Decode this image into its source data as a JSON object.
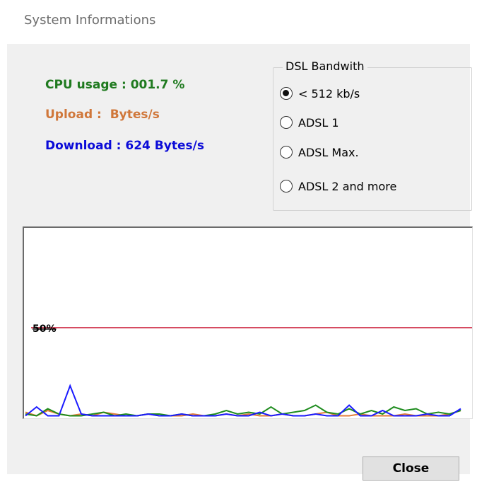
{
  "window": {
    "title": "System Informations"
  },
  "stats": {
    "cpu_label": "CPU usage : ",
    "cpu_value": "001.7 %",
    "upload_label": "Upload : ",
    "upload_value": "Bytes/s",
    "download_label": "Download : ",
    "download_value": "624 Bytes/s"
  },
  "bandwidth": {
    "legend": "DSL Bandwith",
    "options": [
      {
        "label": "< 512 kb/s",
        "checked": true
      },
      {
        "label": "ADSL 1",
        "checked": false
      },
      {
        "label": "ADSL Max.",
        "checked": false
      },
      {
        "label": "ADSL 2 and more",
        "checked": false
      }
    ]
  },
  "graph": {
    "threshold_label": "50%",
    "threshold_color": "#c8102e",
    "series_colors": {
      "cpu": "#1e8c1e",
      "upload": "#e07b39",
      "download": "#1a1aff"
    },
    "cpu": [
      2,
      1,
      5,
      2,
      1,
      1,
      2,
      3,
      1,
      2,
      1,
      2,
      2,
      1,
      2,
      1,
      1,
      2,
      4,
      2,
      3,
      2,
      6,
      2,
      3,
      4,
      7,
      3,
      2,
      5,
      2,
      4,
      2,
      6,
      4,
      5,
      2,
      3,
      2,
      4
    ],
    "upload": [
      3,
      1,
      4,
      2,
      1,
      2,
      1,
      3,
      2,
      1,
      1,
      2,
      1,
      1,
      1,
      2,
      1,
      1,
      2,
      1,
      2,
      1,
      1,
      2,
      1,
      1,
      2,
      3,
      1,
      1,
      2,
      1,
      1,
      1,
      2,
      1,
      1,
      1,
      2,
      4
    ],
    "download": [
      1,
      6,
      1,
      1,
      18,
      2,
      1,
      1,
      1,
      1,
      1,
      2,
      1,
      1,
      2,
      1,
      1,
      1,
      2,
      1,
      1,
      3,
      1,
      2,
      1,
      1,
      2,
      1,
      1,
      7,
      1,
      1,
      4,
      1,
      1,
      1,
      2,
      1,
      1,
      5
    ]
  },
  "buttons": {
    "close_label": "Close"
  }
}
